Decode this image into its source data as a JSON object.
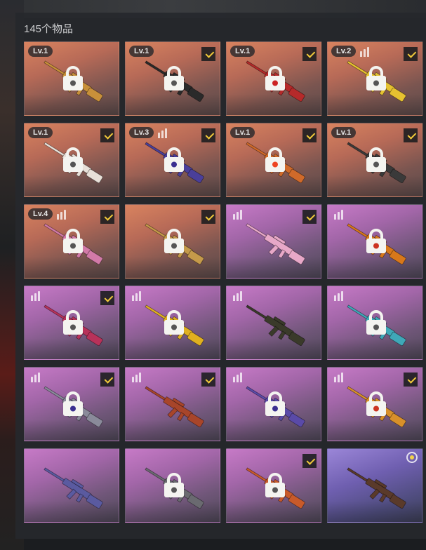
{
  "header": {
    "count_text": "145个物品"
  },
  "colors": {
    "check": "#f1c93a",
    "lock": "#f4f4f0",
    "panel": "#26282c"
  },
  "items": [
    {
      "bg": "orange",
      "level": "Lv.1",
      "bars": false,
      "checked": false,
      "equipped": false,
      "locked": true,
      "weapon_color": "#c8903a",
      "lock_dot": "#555555"
    },
    {
      "bg": "orange",
      "level": "Lv.1",
      "bars": false,
      "checked": true,
      "equipped": false,
      "locked": true,
      "weapon_color": "#2a2a2a",
      "lock_dot": "#555555"
    },
    {
      "bg": "orange",
      "level": "Lv.1",
      "bars": false,
      "checked": true,
      "equipped": false,
      "locked": true,
      "weapon_color": "#b52a2a",
      "lock_dot": "#cc2222"
    },
    {
      "bg": "orange",
      "level": "Lv.2",
      "bars": true,
      "checked": true,
      "equipped": false,
      "locked": true,
      "weapon_color": "#e6c230",
      "lock_dot": "#555555"
    },
    {
      "bg": "orange",
      "level": "Lv.1",
      "bars": false,
      "checked": true,
      "equipped": false,
      "locked": true,
      "weapon_color": "#e8e0d8",
      "lock_dot": "#555555"
    },
    {
      "bg": "orange",
      "level": "Lv.3",
      "bars": true,
      "checked": true,
      "equipped": false,
      "locked": true,
      "weapon_color": "#4a3f9a",
      "lock_dot": "#3a2f90"
    },
    {
      "bg": "orange",
      "level": "Lv.1",
      "bars": false,
      "checked": true,
      "equipped": false,
      "locked": true,
      "weapon_color": "#d06a2a",
      "lock_dot": "#ee4422"
    },
    {
      "bg": "orange",
      "level": "Lv.1",
      "bars": false,
      "checked": true,
      "equipped": false,
      "locked": true,
      "weapon_color": "#3a3a3a",
      "lock_dot": "#555555"
    },
    {
      "bg": "orange",
      "level": "Lv.4",
      "bars": true,
      "checked": true,
      "equipped": false,
      "locked": true,
      "weapon_color": "#d27aa8",
      "lock_dot": "#555555"
    },
    {
      "bg": "orange",
      "level": "",
      "bars": false,
      "checked": true,
      "equipped": false,
      "locked": true,
      "weapon_color": "#c59a4a",
      "lock_dot": "#555555"
    },
    {
      "bg": "purple",
      "level": "",
      "bars": true,
      "checked": true,
      "equipped": false,
      "locked": false,
      "weapon_color": "#e8a8c8",
      "lock_dot": "#555555"
    },
    {
      "bg": "purple",
      "level": "",
      "bars": true,
      "checked": false,
      "equipped": false,
      "locked": true,
      "weapon_color": "#d8781a",
      "lock_dot": "#cc3322"
    },
    {
      "bg": "purple",
      "level": "",
      "bars": true,
      "checked": true,
      "equipped": false,
      "locked": true,
      "weapon_color": "#b8325a",
      "lock_dot": "#555555"
    },
    {
      "bg": "purple",
      "level": "",
      "bars": true,
      "checked": false,
      "equipped": false,
      "locked": true,
      "weapon_color": "#e0b020",
      "lock_dot": "#555555"
    },
    {
      "bg": "purple",
      "level": "",
      "bars": true,
      "checked": false,
      "equipped": false,
      "locked": false,
      "weapon_color": "#3a3a2a",
      "lock_dot": "#555555"
    },
    {
      "bg": "purple",
      "level": "",
      "bars": true,
      "checked": false,
      "equipped": false,
      "locked": true,
      "weapon_color": "#3fa8b8",
      "lock_dot": "#555555"
    },
    {
      "bg": "purple",
      "level": "",
      "bars": true,
      "checked": true,
      "equipped": false,
      "locked": true,
      "weapon_color": "#8a8a9a",
      "lock_dot": "#3a2f90"
    },
    {
      "bg": "purple",
      "level": "",
      "bars": true,
      "checked": true,
      "equipped": false,
      "locked": false,
      "weapon_color": "#a8452a",
      "lock_dot": "#555555"
    },
    {
      "bg": "purple",
      "level": "",
      "bars": true,
      "checked": false,
      "equipped": false,
      "locked": true,
      "weapon_color": "#5a4aa8",
      "lock_dot": "#3a2f90"
    },
    {
      "bg": "purple",
      "level": "",
      "bars": true,
      "checked": true,
      "equipped": false,
      "locked": true,
      "weapon_color": "#d8902a",
      "lock_dot": "#cc3322"
    },
    {
      "bg": "purple",
      "level": "",
      "bars": false,
      "checked": false,
      "equipped": false,
      "locked": false,
      "weapon_color": "#5a5aa0",
      "lock_dot": "#555555"
    },
    {
      "bg": "purple",
      "level": "",
      "bars": false,
      "checked": false,
      "equipped": false,
      "locked": true,
      "weapon_color": "#6a6a70",
      "lock_dot": "#555555"
    },
    {
      "bg": "purple",
      "level": "",
      "bars": false,
      "checked": true,
      "equipped": false,
      "locked": true,
      "weapon_color": "#c85a2a",
      "lock_dot": "#555555"
    },
    {
      "bg": "blue",
      "level": "",
      "bars": false,
      "checked": false,
      "equipped": true,
      "locked": false,
      "weapon_color": "#5a3a2a",
      "lock_dot": "#555555"
    }
  ]
}
